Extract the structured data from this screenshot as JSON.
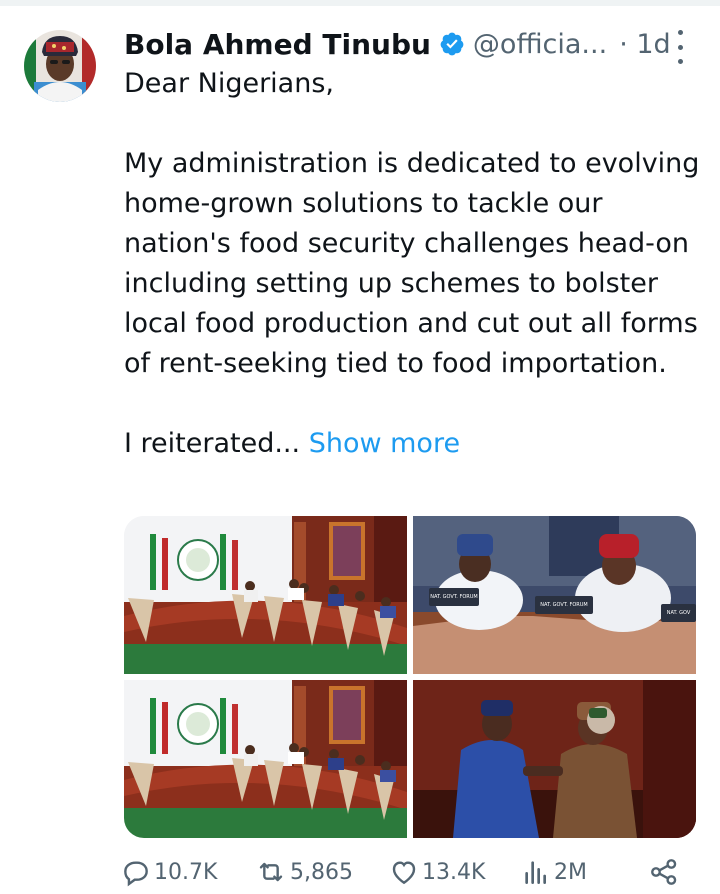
{
  "author": {
    "name": "Bola Ahmed Tinubu",
    "handle": "@officia...",
    "time": "· 1d"
  },
  "tweet": {
    "greeting": "Dear Nigerians,",
    "paragraph": "My administration is dedicated to evolving home-grown solutions to tackle our nation's food security challenges head-on including setting up schemes to bolster local food production and cut out all forms of rent-seeking tied to food importation.",
    "truncated": "I reiterated...",
    "show_more": "Show more"
  },
  "media": {
    "images": [
      {
        "name": "council-chamber-wide"
      },
      {
        "name": "officials-at-table"
      },
      {
        "name": "council-chamber-wide-2"
      },
      {
        "name": "officials-greeting"
      }
    ],
    "desk_signs": [
      "NAT. GOVT. FORUM",
      "NAT. GOVT. FORUM",
      "NAT. GOV"
    ]
  },
  "actions": {
    "replies": "10.7K",
    "reposts": "5,865",
    "likes": "13.4K",
    "views": "2M"
  },
  "colors": {
    "link": "#1d9bf0",
    "verified": "#1d9bf0",
    "secondary_text": "#536471"
  },
  "icons": [
    "verified-badge-icon",
    "more-options-icon",
    "reply-icon",
    "repost-icon",
    "like-icon",
    "views-icon",
    "share-icon"
  ]
}
